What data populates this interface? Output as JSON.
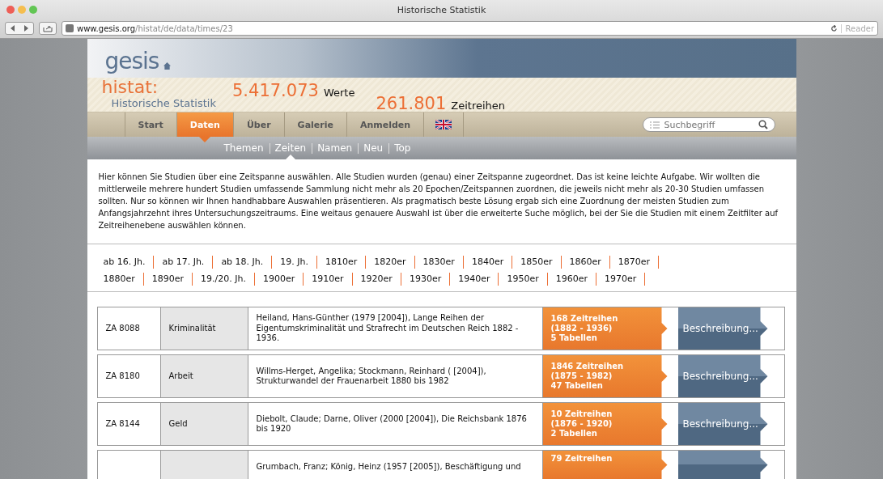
{
  "window": {
    "title": "Historische Statistik"
  },
  "browser": {
    "url": "**www.gesis.org**/histat/de/data/times/23",
    "reader": "Reader"
  },
  "header": {
    "logo": "gesis",
    "brand": "histat:",
    "subtitle": "Historische Statistik",
    "stats": [
      {
        "value": "5.417.073",
        "label": "Werte"
      },
      {
        "value": "261.801",
        "label": "Zeitreihen"
      }
    ]
  },
  "nav": {
    "tabs": [
      {
        "label": "Start",
        "selected": false,
        "kind": "text"
      },
      {
        "label": "Daten",
        "selected": true,
        "kind": "text"
      },
      {
        "label": "Über",
        "selected": false,
        "kind": "text"
      },
      {
        "label": "Galerie",
        "selected": false,
        "kind": "text"
      },
      {
        "label": "Anmelden",
        "selected": false,
        "kind": "text"
      },
      {
        "selected": false,
        "kind": "flag"
      }
    ],
    "search": {
      "placeholder": "Suchbegriff"
    }
  },
  "subnav": [
    {
      "label": "Themen",
      "selected": false
    },
    {
      "label": "Zeiten",
      "selected": true
    },
    {
      "label": "Namen",
      "selected": false
    },
    {
      "label": "Neu",
      "selected": false
    },
    {
      "label": "Top",
      "selected": false
    }
  ],
  "intro": "Hier können Sie Studien über eine Zeitspanne auswählen. Alle Studien wurden (genau) einer Zeitspanne zugeordnet. Das ist keine leichte Aufgabe. Wir wollten die mittlerweile mehrere hundert Studien umfassende Sammlung nicht mehr als 20 Epochen/Zeitspannen zuordnen, die jeweils nicht mehr als 20-30 Studien umfassen sollten. Nur so können wir Ihnen handhabbare Auswahlen präsentieren. Als pragmatisch beste Lösung ergab sich eine Zuordnung der meisten Studien zum Anfangsjahrzehnt ihres Untersuchungszeitraums. Eine weitaus genauere Auswahl ist über die erweiterte Suche möglich, bei der Sie die Studien mit einem Zeitfilter auf Zeitreihenebene auswählen können.",
  "periods": [
    "ab 16. Jh.",
    "ab 17. Jh.",
    "ab 18. Jh.",
    "19. Jh.",
    "1810er",
    "1820er",
    "1830er",
    "1840er",
    "1850er",
    "1860er",
    "1870er",
    "1880er",
    "1890er",
    "19./20. Jh.",
    "1900er",
    "1910er",
    "1920er",
    "1930er",
    "1940er",
    "1950er",
    "1960er",
    "1970er"
  ],
  "studies": [
    {
      "id": "ZA 8088",
      "topic": "Kriminalität",
      "citation": "Heiland, Hans-Günther (1979 [2004]), Lange Reihen der Eigentumskriminalität und Strafrecht im Deutschen Reich 1882 - 1936.",
      "series": [
        "168 Zeitreihen",
        "(1882 - 1936)",
        "5 Tabellen"
      ],
      "button": "Beschreibung..."
    },
    {
      "id": "ZA 8180",
      "topic": "Arbeit",
      "citation": "Willms-Herget, Angelika; Stockmann, Reinhard ( [2004]), Strukturwandel der Frauenarbeit 1880 bis 1982",
      "series": [
        "1846 Zeitreihen",
        "(1875 - 1982)",
        "47 Tabellen"
      ],
      "button": "Beschreibung..."
    },
    {
      "id": "ZA 8144",
      "topic": "Geld",
      "citation": "Diebolt, Claude; Darne, Oliver (2000 [2004]), Die Reichsbank 1876 bis 1920",
      "series": [
        "10 Zeitreihen",
        "(1876 - 1920)",
        "2 Tabellen"
      ],
      "button": "Beschreibung..."
    },
    {
      "citation": "Grumbach, Franz; König, Heinz (1957 [2005]), Beschäftigung und",
      "series": [
        "79 Zeitreihen"
      ]
    }
  ]
}
